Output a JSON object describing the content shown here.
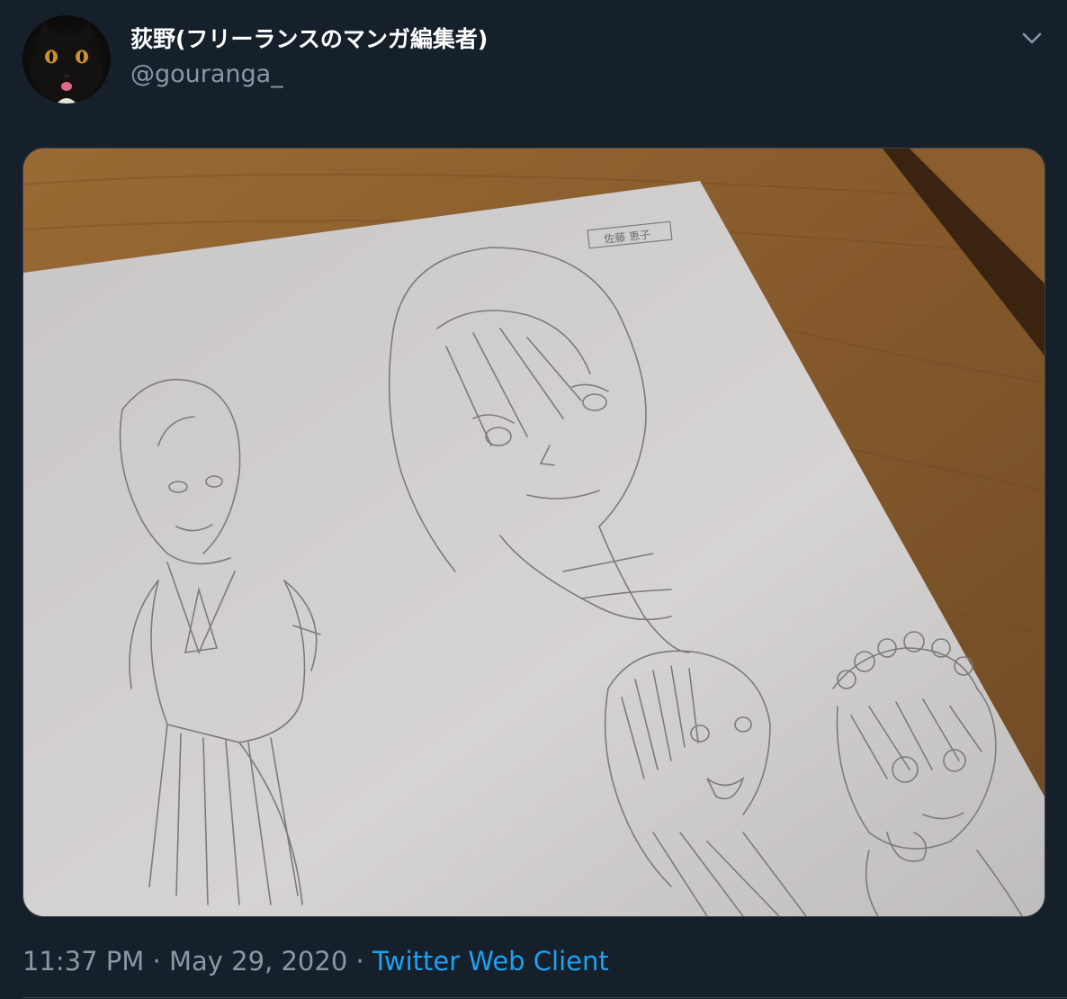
{
  "tweet": {
    "author": {
      "display_name": "荻野(フリーランスのマンガ編集者)",
      "handle": "@gouranga_",
      "avatar": "black-cat-avatar"
    },
    "more_icon": "chevron-down-icon",
    "media": {
      "type": "photo",
      "subject": "pencil manga character sketches on paper on a wooden table",
      "paper_label": "佐藤 恵子"
    },
    "meta": {
      "time": "11:37 PM",
      "separator": "·",
      "date": "May 29, 2020",
      "source": "Twitter Web Client"
    }
  },
  "colors": {
    "background": "#15202b",
    "display_name": "#ffffff",
    "secondary_text": "#8899a6",
    "link": "#1da1f2",
    "border": "#38444d"
  }
}
